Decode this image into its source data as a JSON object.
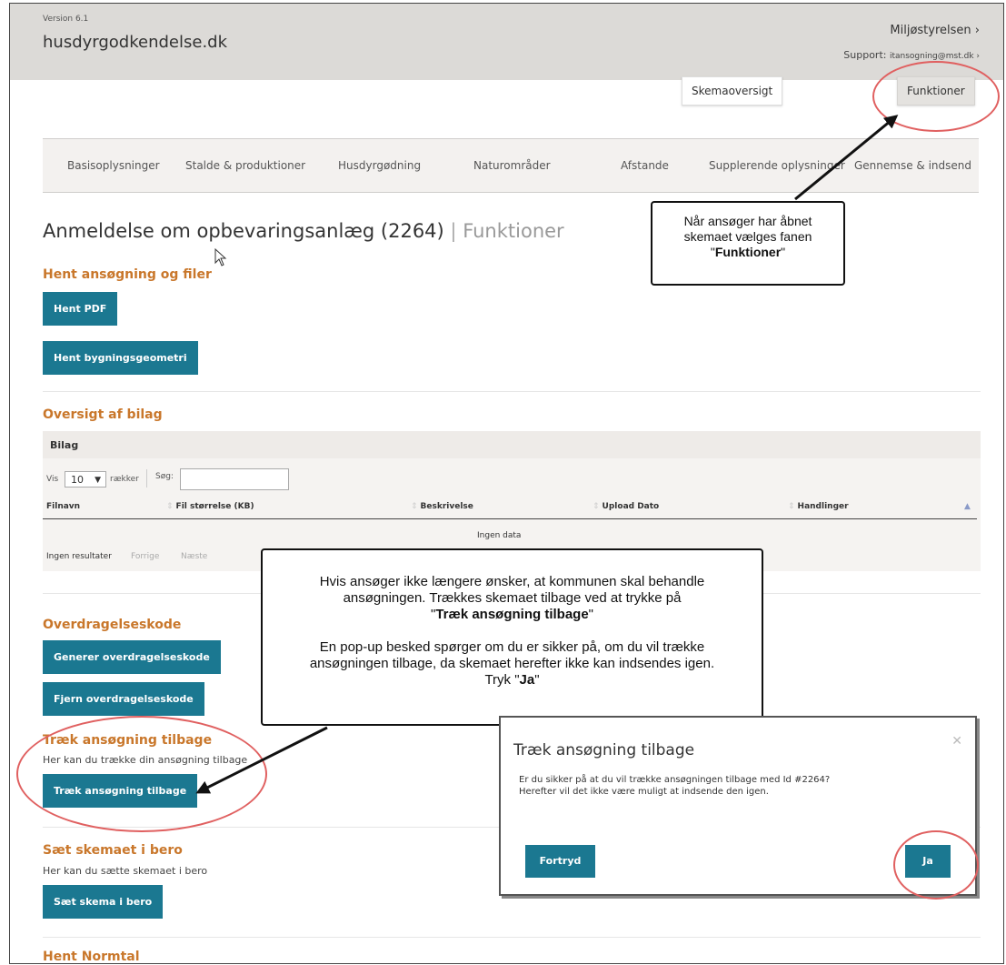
{
  "header": {
    "version": "Version 6.1",
    "brand": "husdyrgodkendelse.dk",
    "ministry": "Miljøstyrelsen ›",
    "support_label": "Support:",
    "support_email": "itansogning@mst.dk ›"
  },
  "top_buttons": {
    "overview": "Skemaoversigt",
    "functions": "Funktioner"
  },
  "nav": {
    "items": [
      "Basisoplysninger",
      "Stalde & produktioner",
      "Husdyrgødning",
      "Naturområder",
      "Afstande",
      "Supplerende oplysninger",
      "Gennemse & indsend"
    ]
  },
  "page": {
    "title": "Anmeldelse om opbevaringsanlæg (2264)",
    "separator": "|",
    "subtitle": "Funktioner"
  },
  "sections": {
    "files": {
      "heading": "Hent ansøgning og filer",
      "pdf_button": "Hent PDF",
      "geometry_button": "Hent bygningsgeometri"
    },
    "attachments": {
      "heading": "Oversigt af bilag",
      "table_title": "Bilag",
      "show_label": "Vis",
      "page_size": "10",
      "rows_label": "rækker",
      "search_label": "Søg:",
      "columns": [
        "Filnavn",
        "Fil størrelse (KB)",
        "Beskrivelse",
        "Upload Dato",
        "Handlinger"
      ],
      "empty_text": "Ingen data",
      "results_text": "Ingen resultater",
      "prev_label": "Forrige",
      "next_label": "Næste"
    },
    "transfer": {
      "heading": "Overdragelseskode",
      "generate_button": "Generer overdragelseskode",
      "remove_button": "Fjern overdragelseskode"
    },
    "withdraw": {
      "heading": "Træk ansøgning tilbage",
      "description": "Her kan du trække din ansøgning tilbage",
      "button": "Træk ansøgning tilbage"
    },
    "pause": {
      "heading": "Sæt skemaet i bero",
      "description": "Her kan du sætte skemaet i bero",
      "button": "Sæt skema i bero"
    },
    "normtal": {
      "heading": "Hent Normtal"
    }
  },
  "callouts": {
    "functions_tab": {
      "line1": "Når ansøger har åbnet",
      "line2": "skemaet vælges fanen",
      "quote_open": "\"",
      "bold": "Funktioner",
      "quote_close": "\""
    },
    "withdraw": {
      "line1": "Hvis ansøger ikke længere ønsker, at kommunen skal behandle",
      "line2": "ansøgningen. Trækkes skemaet tilbage ved at trykke på",
      "bold1": "Træk ansøgning tilbage",
      "line3": "En pop-up besked spørger om du er sikker på, om du vil trække",
      "line4": "ansøgningen tilbage, da skemaet herefter ikke kan indsendes igen.",
      "tryk": "Tryk",
      "bold2": "Ja"
    }
  },
  "modal": {
    "title": "Træk ansøgning tilbage",
    "message_line1": "Er du sikker på at du vil trække ansøgningen tilbage med Id #2264?",
    "message_line2": "Herefter vil det ikke være muligt at indsende den igen.",
    "cancel_button": "Fortryd",
    "confirm_button": "Ja"
  },
  "colors": {
    "primary_button": "#1b7891",
    "section_heading": "#c9772b",
    "highlight_ellipse": "#e06060",
    "header_bg": "#dcdad7"
  },
  "icons": [
    "close-icon",
    "sort-icon",
    "dropdown-caret-icon",
    "mouse-cursor-icon",
    "arrow-annotation"
  ]
}
